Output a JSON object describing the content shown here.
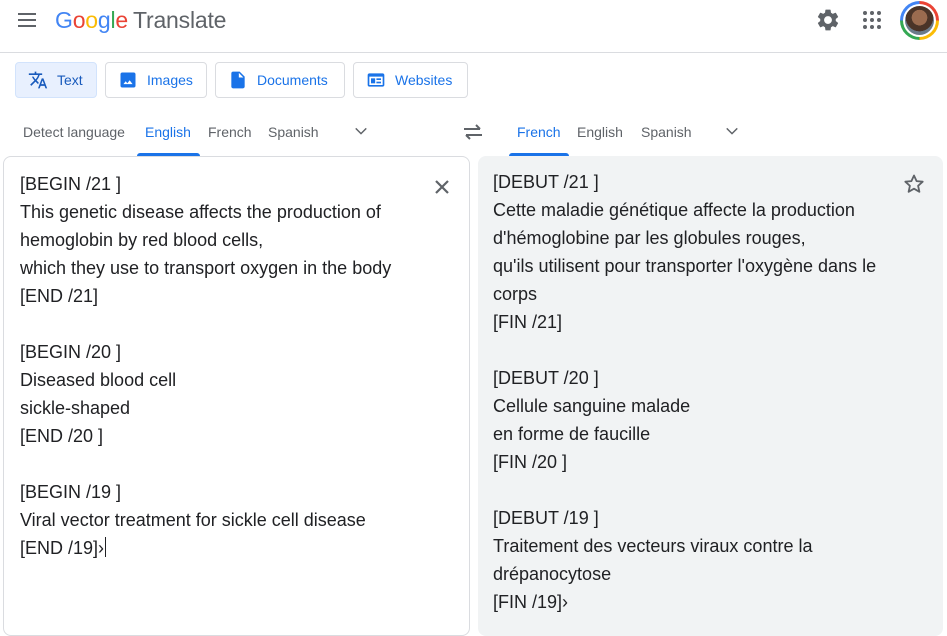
{
  "header": {
    "logo_letters": [
      "G",
      "o",
      "o",
      "g",
      "l",
      "e"
    ],
    "product_name": "Translate",
    "icons": [
      "menu-icon",
      "gear-icon",
      "apps-grid-icon",
      "avatar"
    ]
  },
  "modes": [
    {
      "label": "Text",
      "icon": "translate-icon",
      "active": true
    },
    {
      "label": "Images",
      "icon": "image-icon",
      "active": false
    },
    {
      "label": "Documents",
      "icon": "document-icon",
      "active": false
    },
    {
      "label": "Websites",
      "icon": "website-icon",
      "active": false
    }
  ],
  "source_languages": [
    "Detect language",
    "English",
    "French",
    "Spanish"
  ],
  "source_selected": "English",
  "target_languages": [
    "French",
    "English",
    "Spanish"
  ],
  "target_selected": "French",
  "source_text": "[BEGIN /21 ]\nThis genetic disease affects the production of\nhemoglobin by red blood cells,\nwhich they use to transport oxygen in the body\n[END /21]\n\n[BEGIN /20 ]\nDiseased blood cell\nsickle-shaped\n[END /20 ]\n\n[BEGIN /19 ]\nViral vector treatment for sickle cell disease\n[END /19]›",
  "target_text": "[DEBUT /21 ]\nCette maladie génétique affecte la production\nd'hémoglobine par les globules rouges,\nqu'ils utilisent pour transporter l'oxygène dans le\ncorps\n[FIN /21]\n\n[DEBUT /20 ]\nCellule sanguine malade\nen forme de faucille\n[FIN /20 ]\n\n[DEBUT /19 ]\nTraitement des vecteurs viraux contre la\ndrépanocytose\n[FIN /19]›",
  "colors": {
    "accent": "#1a73e8",
    "active_tab_bg": "#e8f0fe",
    "target_panel_bg": "#f1f3f4",
    "border": "#dadce0"
  }
}
